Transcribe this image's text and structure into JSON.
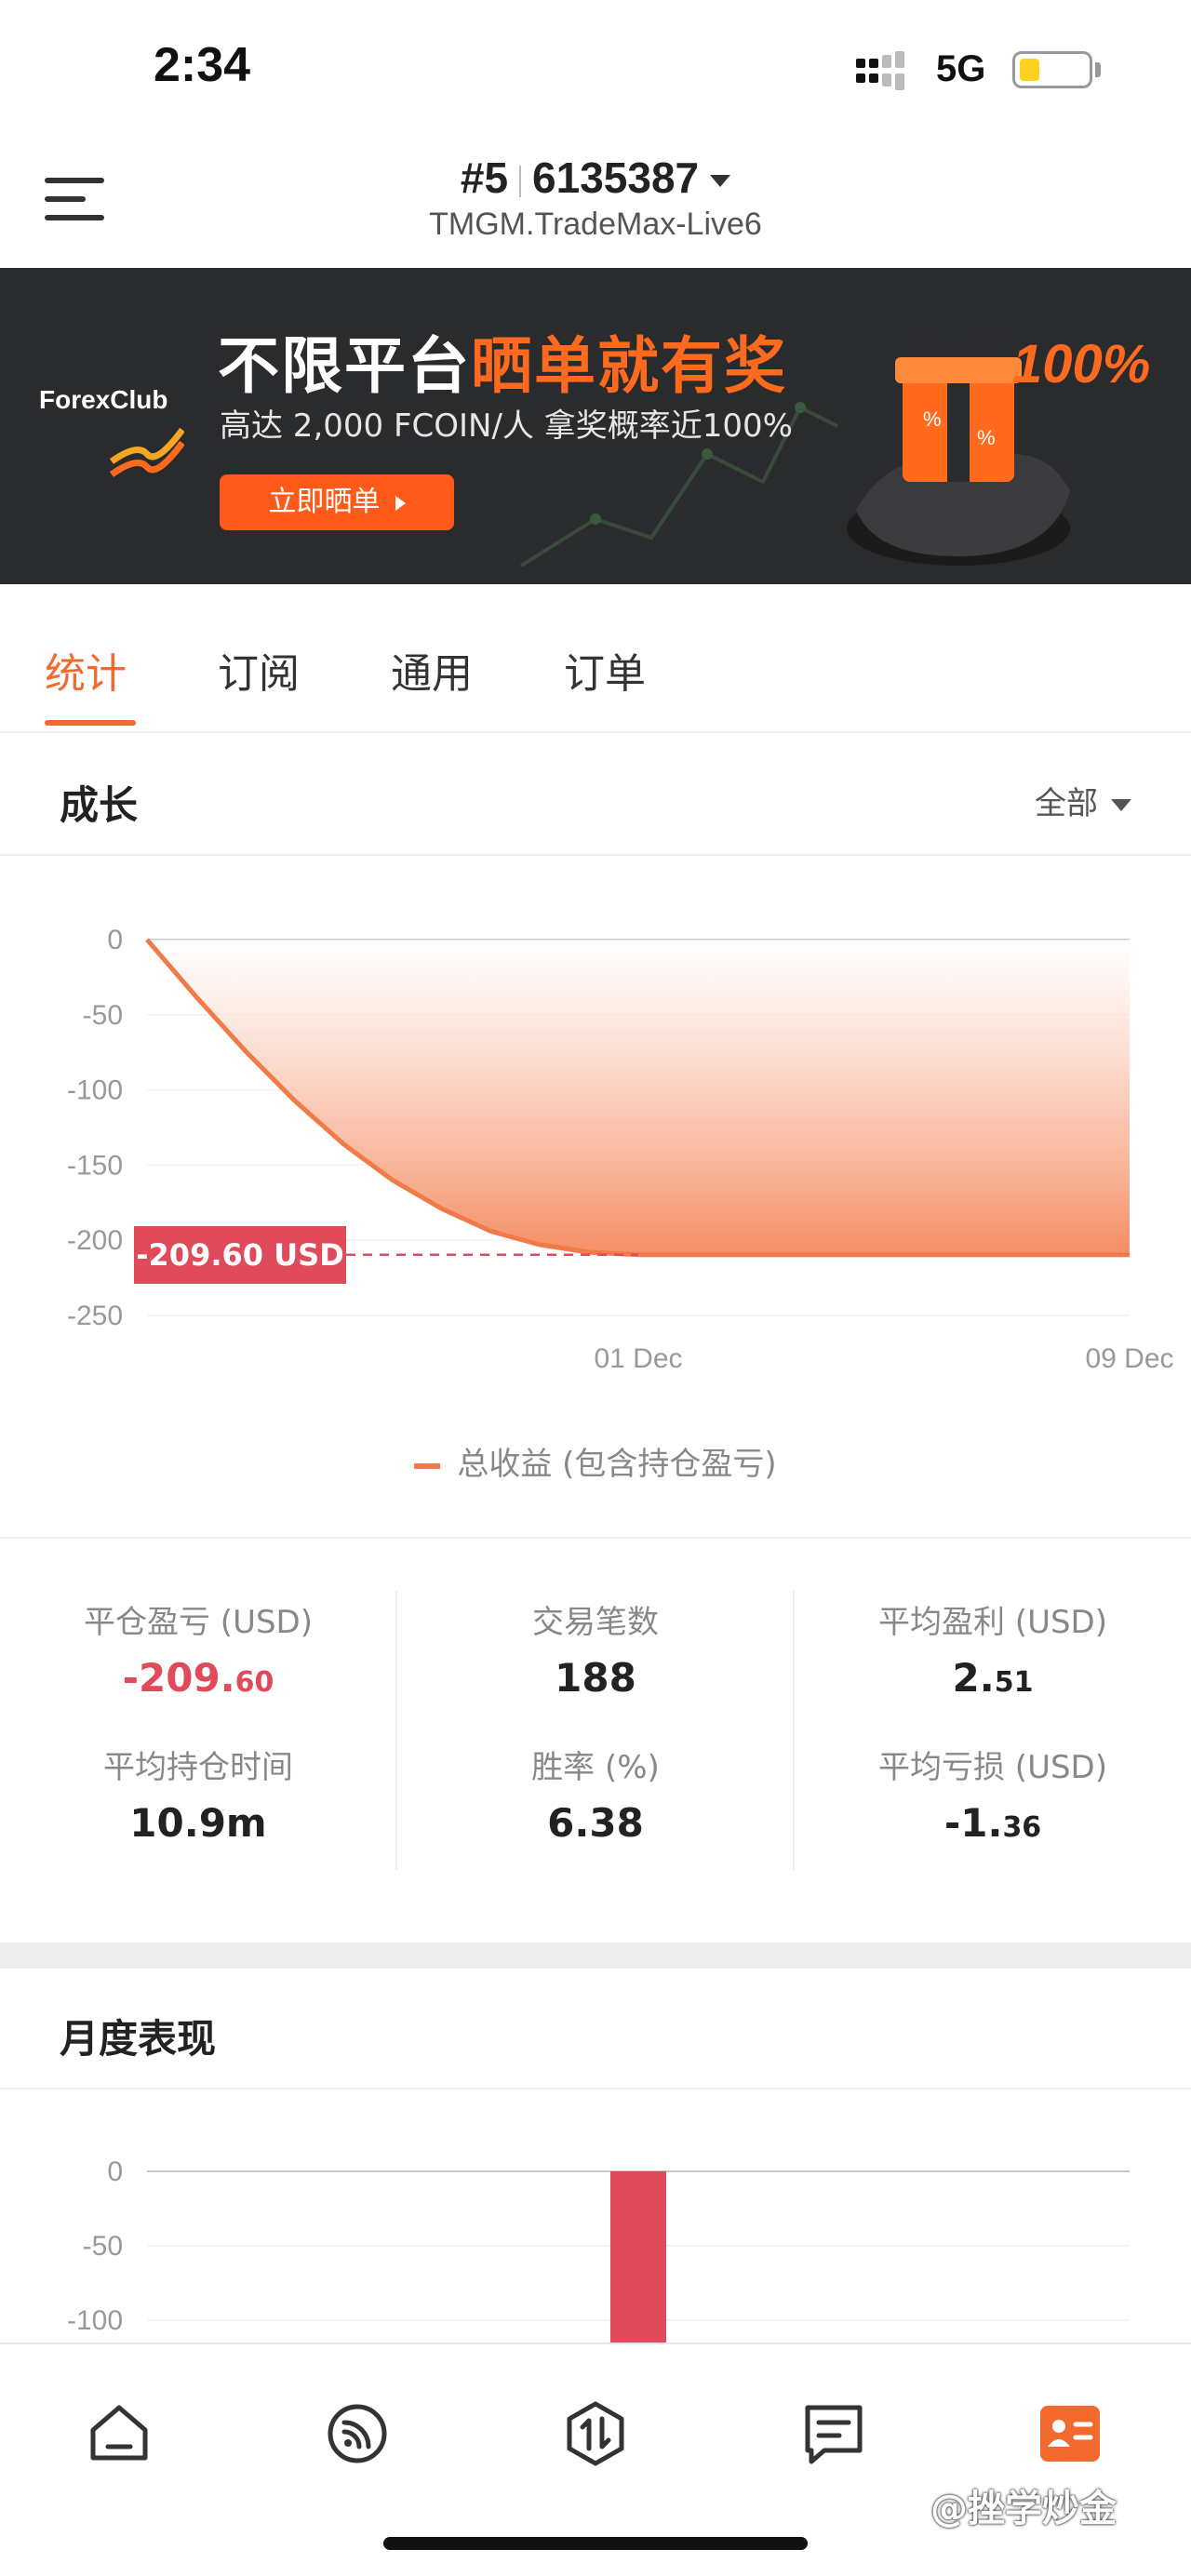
{
  "status_bar": {
    "time": "2:34",
    "network": "5G",
    "battery_level": 0.28
  },
  "header": {
    "account_prefix": "#5",
    "account_number": "6135387",
    "server": "TMGM.TradeMax-Live6"
  },
  "banner": {
    "logo_text": "ForexClub",
    "headline_white": "不限平台",
    "headline_orange": "晒单就有奖",
    "subtitle": "高达 2,000 FCOIN/人  拿奖概率近100%",
    "button_label": "立即晒单",
    "percent_text": "100%",
    "accent_color": "#ff5a1a"
  },
  "tabs": [
    {
      "label": "统计",
      "active": true
    },
    {
      "label": "订阅",
      "active": false
    },
    {
      "label": "通用",
      "active": false
    },
    {
      "label": "订单",
      "active": false
    }
  ],
  "growth": {
    "title": "成长",
    "range_label": "全部",
    "last_value_label": "-209.60 USD",
    "legend_label": "总收益 (包含持仓盈亏)"
  },
  "chart_data": [
    {
      "type": "area",
      "title": "成长",
      "x_tick_labels": [
        "01 Dec",
        "09 Dec"
      ],
      "y_ticks": [
        0,
        -50,
        -100,
        -150,
        -200,
        -250
      ],
      "ylim": [
        -250,
        0
      ],
      "x_range": [
        "start",
        "09 Dec"
      ],
      "series": [
        {
          "name": "总收益 (包含持仓盈亏)",
          "color": "#f07a48",
          "x": [
            0,
            0.1,
            0.2,
            0.3,
            0.4,
            0.5,
            0.6,
            0.7,
            0.8,
            0.9,
            1.0,
            1.5,
            2.0
          ],
          "values": [
            0,
            -38,
            -74,
            -107,
            -136,
            -160,
            -179,
            -194,
            -203,
            -208,
            -209.6,
            -209.6,
            -209.6
          ]
        }
      ],
      "reference_line": {
        "value": -209.6,
        "label": "-209.60 USD",
        "style": "dashed",
        "color": "#e04a5a"
      },
      "grid": true
    },
    {
      "type": "bar",
      "title": "月度表现",
      "y_ticks": [
        0,
        -50,
        -100
      ],
      "ylim": [
        -100,
        0
      ],
      "series": [
        {
          "bar_color": "#e04a5a",
          "values": [
            -209.6
          ]
        }
      ],
      "grid": true
    }
  ],
  "stats": [
    {
      "label": "平仓盈亏 (USD)",
      "int_part": "-209.",
      "dec_part": "60",
      "negative": true
    },
    {
      "label": "交易笔数",
      "int_part": "188",
      "dec_part": "",
      "negative": false
    },
    {
      "label": "平均盈利 (USD)",
      "int_part": "2.",
      "dec_part": "51",
      "negative": false
    },
    {
      "label": "平均持仓时间",
      "int_part": "10.9m",
      "dec_part": "",
      "negative": false
    },
    {
      "label": "胜率 (%)",
      "int_part": "6.38",
      "dec_part": "",
      "negative": false
    },
    {
      "label": "平均亏损 (USD)",
      "int_part": "-1.",
      "dec_part": "36",
      "negative": false
    }
  ],
  "monthly": {
    "title": "月度表现"
  },
  "bottom_nav": [
    {
      "icon": "home-icon",
      "active": false
    },
    {
      "icon": "feed-icon",
      "active": false
    },
    {
      "icon": "trade-icon",
      "active": false
    },
    {
      "icon": "message-icon",
      "active": false
    },
    {
      "icon": "profile-card-icon",
      "active": true
    }
  ],
  "watermark": "@挫学炒金",
  "colors": {
    "accent": "#f26a2e",
    "negative": "#e04a5a"
  }
}
